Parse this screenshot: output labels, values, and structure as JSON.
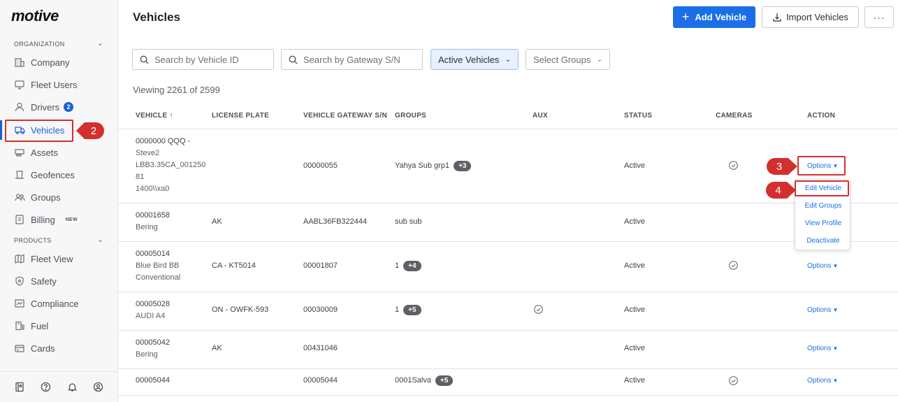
{
  "logo": "motive",
  "sidebar": {
    "org_heading": "ORGANIZATION",
    "products_heading": "PRODUCTS",
    "org_items": [
      {
        "label": "Company"
      },
      {
        "label": "Fleet Users"
      },
      {
        "label": "Drivers",
        "badge": "2"
      },
      {
        "label": "Vehicles"
      },
      {
        "label": "Assets"
      },
      {
        "label": "Geofences"
      },
      {
        "label": "Groups"
      },
      {
        "label": "Billing",
        "badge": "NEW"
      }
    ],
    "product_items": [
      {
        "label": "Fleet View"
      },
      {
        "label": "Safety"
      },
      {
        "label": "Compliance"
      },
      {
        "label": "Fuel"
      },
      {
        "label": "Cards"
      }
    ]
  },
  "header": {
    "title": "Vehicles",
    "add_label": "Add Vehicle",
    "import_label": "Import Vehicles",
    "more_label": "···"
  },
  "filters": {
    "vehicle_search_placeholder": "Search by Vehicle ID",
    "gateway_search_placeholder": "Search by Gateway S/N",
    "status_value": "Active Vehicles",
    "groups_placeholder": "Select Groups"
  },
  "viewing": "Viewing 2261 of 2599",
  "table": {
    "columns": [
      "VEHICLE ↑",
      "LICENSE PLATE",
      "VEHICLE GATEWAY S/N",
      "GROUPS",
      "AUX",
      "STATUS",
      "CAMERAS",
      "ACTION"
    ],
    "rows": [
      {
        "vehicle": "0000000 QQQ -",
        "vehicle_sub": [
          "Steve2",
          "LBB3.35CA_001250",
          "81",
          "1400\\\\xa0"
        ],
        "plate": "",
        "gateway": "00000055",
        "group": "Yahya Sub grp1",
        "group_more": "+3",
        "aux": false,
        "status": "Active",
        "camera": true,
        "action": "Options"
      },
      {
        "vehicle": "00001658",
        "vehicle_sub": [
          "Bering"
        ],
        "plate": "AK",
        "gateway": "AABL36FB322444",
        "group": "sub sub",
        "group_more": "",
        "aux": false,
        "status": "Active",
        "camera": false,
        "action": ""
      },
      {
        "vehicle": "00005014",
        "vehicle_sub": [
          "Blue Bird BB",
          "Conventional"
        ],
        "plate": "CA - KT5014",
        "gateway": "00001807",
        "group": "1",
        "group_more": "+4",
        "aux": false,
        "status": "Active",
        "camera": true,
        "action": "Options"
      },
      {
        "vehicle": "00005028",
        "vehicle_sub": [
          "AUDI A4"
        ],
        "plate": "ON - OWFK-593",
        "gateway": "00030009",
        "group": "1",
        "group_more": "+5",
        "aux": true,
        "status": "Active",
        "camera": false,
        "action": "Options"
      },
      {
        "vehicle": "00005042",
        "vehicle_sub": [
          "Bering"
        ],
        "plate": "AK",
        "gateway": "00431046",
        "group": "",
        "group_more": "",
        "aux": false,
        "status": "Active",
        "camera": false,
        "action": "Options"
      },
      {
        "vehicle": "00005044",
        "vehicle_sub": [],
        "plate": "",
        "gateway": "00005044",
        "group": "0001Salva",
        "group_more": "+5",
        "aux": false,
        "status": "Active",
        "camera": true,
        "action": "Options"
      }
    ]
  },
  "dropdown": {
    "items": [
      "Edit Vehicle",
      "Edit Groups",
      "View Profile",
      "Deactivate"
    ]
  },
  "callouts": {
    "c2": "2",
    "c3": "3",
    "c4": "4"
  },
  "colors": {
    "accent": "#1a6fe6",
    "annotation": "#d32f2f"
  }
}
